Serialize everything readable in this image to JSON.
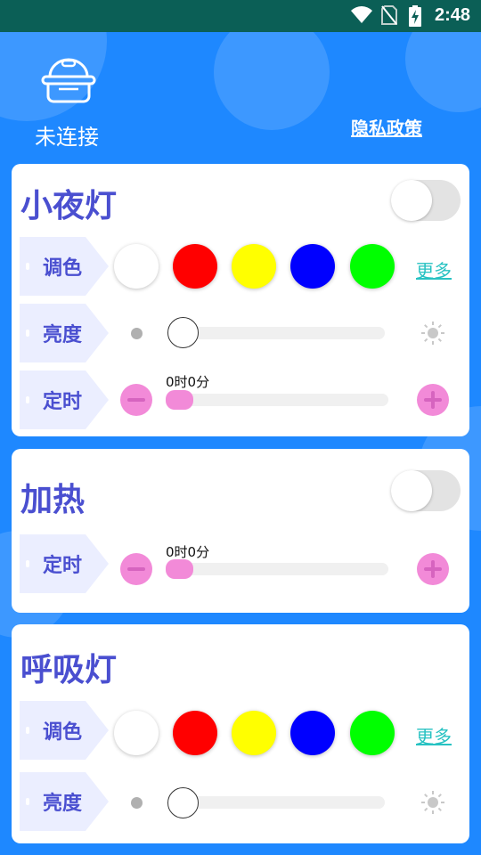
{
  "status_bar": {
    "time": "2:48"
  },
  "header": {
    "connection_status": "未连接",
    "privacy_link": "隐私政策"
  },
  "colors": {
    "accent": "#4a4fd0",
    "background": "#1e88ff",
    "swatches": [
      "#ffffff",
      "#ff0000",
      "#ffff00",
      "#0000ff",
      "#00ff00"
    ]
  },
  "night_light": {
    "title": "小夜灯",
    "switch_on": false,
    "color_label": "调色",
    "more_label": "更多",
    "brightness_label": "亮度",
    "brightness_value": 0,
    "timer_label": "定时",
    "timer_value": "0时0分"
  },
  "heating": {
    "title": "加热",
    "switch_on": false,
    "timer_label": "定时",
    "timer_value": "0时0分"
  },
  "breathing_light": {
    "title": "呼吸灯",
    "color_label": "调色",
    "more_label": "更多",
    "brightness_label": "亮度",
    "brightness_value": 0
  }
}
